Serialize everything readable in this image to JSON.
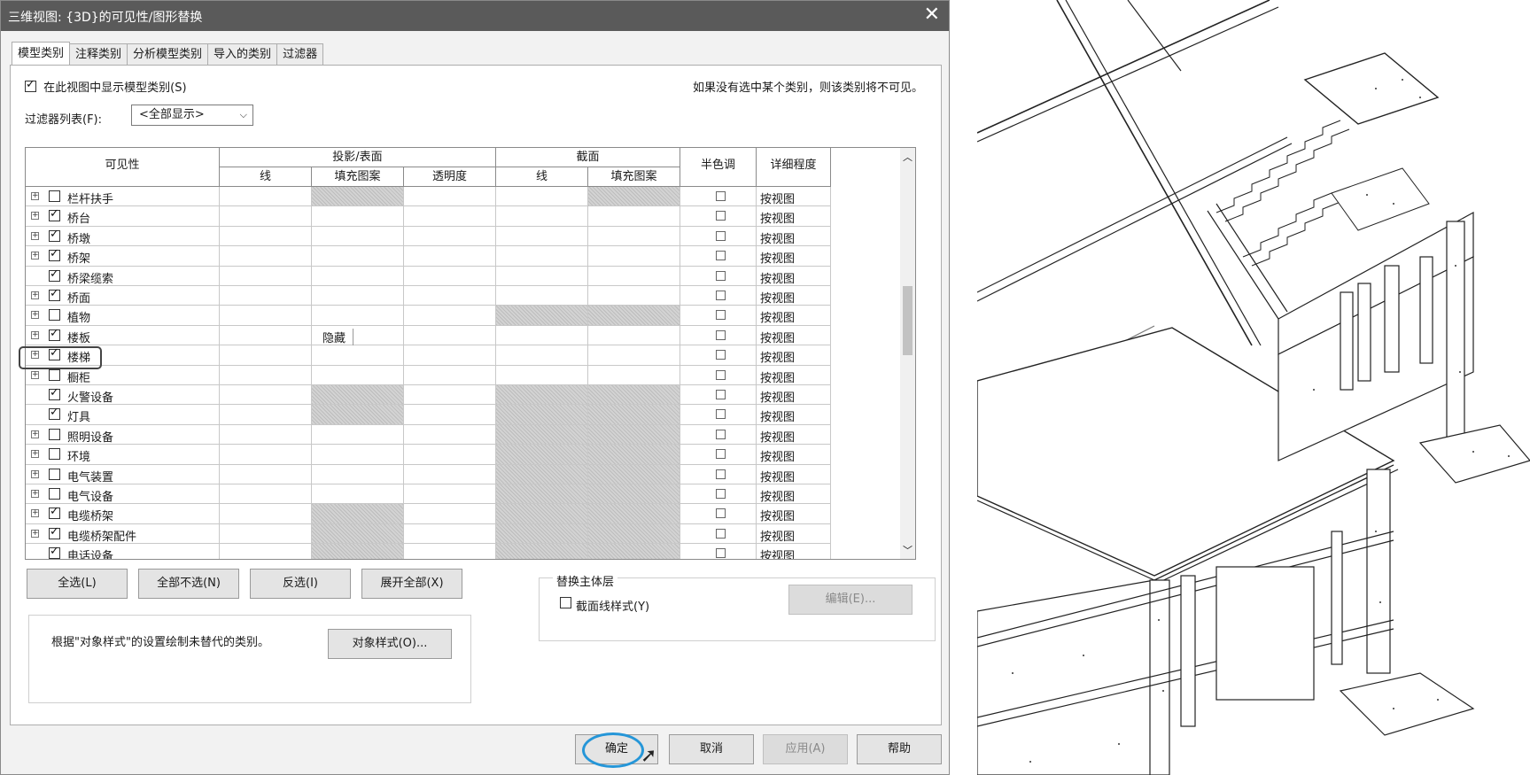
{
  "dialog": {
    "title": "三维视图: {3D}的可见性/图形替换",
    "close_glyph": "✕",
    "tabs": [
      "模型类别",
      "注释类别",
      "分析模型类别",
      "导入的类别",
      "过滤器"
    ],
    "show_model_categories": "在此视图中显示模型类别(S)",
    "hint": "如果没有选中某个类别，则该类别将不可见。",
    "filter_label": "过滤器列表(F):",
    "filter_value": "<全部显示>",
    "headers": {
      "visibility": "可见性",
      "projection": "投影/表面",
      "line": "线",
      "fill": "填充图案",
      "transparency": "透明度",
      "section": "截面",
      "section_line": "线",
      "section_fill": "填充图案",
      "halftone": "半色调",
      "detail": "详细程度"
    },
    "rows": [
      {
        "name": "栏杆扶手",
        "checked": false,
        "plus": true
      },
      {
        "name": "桥台",
        "checked": true,
        "plus": true
      },
      {
        "name": "桥墩",
        "checked": true,
        "plus": true
      },
      {
        "name": "桥架",
        "checked": true,
        "plus": true
      },
      {
        "name": "桥梁缆索",
        "checked": true,
        "plus": false
      },
      {
        "name": "桥面",
        "checked": true,
        "plus": true
      },
      {
        "name": "植物",
        "checked": false,
        "plus": true
      },
      {
        "name": "楼板",
        "checked": true,
        "plus": true
      },
      {
        "name": "楼梯",
        "checked": true,
        "plus": true
      },
      {
        "name": "橱柜",
        "checked": false,
        "plus": true
      },
      {
        "name": "火警设备",
        "checked": true,
        "plus": false
      },
      {
        "name": "灯具",
        "checked": true,
        "plus": false
      },
      {
        "name": "照明设备",
        "checked": false,
        "plus": true
      },
      {
        "name": "环境",
        "checked": false,
        "plus": true
      },
      {
        "name": "电气装置",
        "checked": false,
        "plus": true
      },
      {
        "name": "电气设备",
        "checked": false,
        "plus": true
      },
      {
        "name": "电缆桥架",
        "checked": true,
        "plus": true
      },
      {
        "name": "电缆桥架配件",
        "checked": true,
        "plus": true
      },
      {
        "name": "电话设备",
        "checked": true,
        "plus": false
      }
    ],
    "detail_value": "按视图",
    "hidden_value": "隐藏",
    "buttons": {
      "select_all": "全选(L)",
      "select_none": "全部不选(N)",
      "invert": "反选(I)",
      "expand_all": "展开全部(X)",
      "object_styles": "对象样式(O)...",
      "edit": "编辑(E)...",
      "ok": "确定",
      "cancel": "取消",
      "apply": "应用(A)",
      "help": "帮助"
    },
    "host_layer_title": "替换主体层",
    "section_line_style": "截面线样式(Y)",
    "object_style_note": "根据\"对象样式\"的设置绘制未替代的类别。"
  }
}
